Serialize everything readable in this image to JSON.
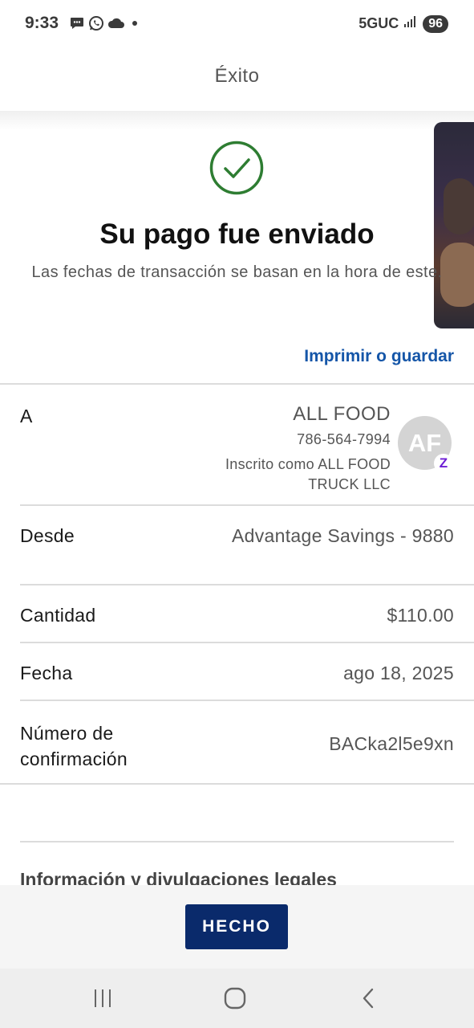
{
  "status_bar": {
    "time": "9:33",
    "network": "5GUC",
    "battery": "96",
    "icons": [
      "message-icon",
      "whatsapp-icon",
      "cloud-icon",
      "dot-icon",
      "signal-icon"
    ]
  },
  "header": {
    "title": "Éxito"
  },
  "success": {
    "icon": "check-circle-icon",
    "title": "Su pago fue enviado",
    "subtitle": "Las fechas de transacción se basan en la hora de este."
  },
  "print_link": "Imprimir o guardar",
  "details": {
    "to": {
      "label": "A",
      "name": "ALL FOOD",
      "phone": "786-564-7994",
      "enrolled": "Inscrito como ALL FOOD TRUCK LLC",
      "avatar_initials": "AF",
      "badge": "Z"
    },
    "from": {
      "label": "Desde",
      "value": "Advantage Savings - 9880"
    },
    "amount": {
      "label": "Cantidad",
      "value": "$110.00"
    },
    "date": {
      "label": "Fecha",
      "value": "ago 18, 2025"
    },
    "confirmation": {
      "label": "Número de confirmación",
      "value": "BACka2l5e9xn"
    }
  },
  "legal_title": "Información y divulgaciones legales",
  "done_button": "HECHO",
  "colors": {
    "brand_navy": "#0a2a6b",
    "link_blue": "#1556a8",
    "success_green": "#2e7d32",
    "zelle_purple": "#6d1ed4"
  }
}
